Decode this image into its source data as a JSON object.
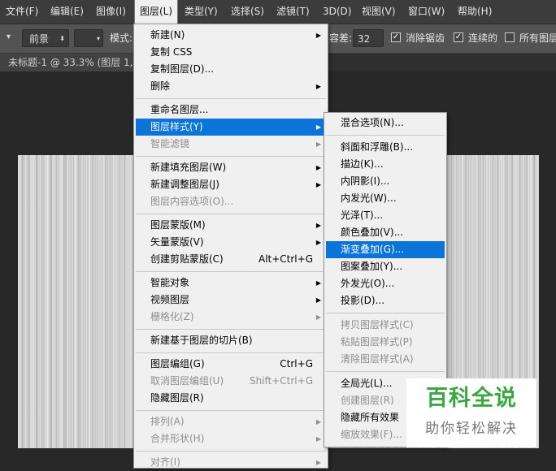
{
  "menubar": {
    "items": [
      "文件(F)",
      "编辑(E)",
      "图像(I)",
      "图层(L)",
      "类型(Y)",
      "选择(S)",
      "滤镜(T)",
      "3D(D)",
      "视图(V)",
      "窗口(W)",
      "帮助(H)"
    ],
    "active": "图层(L)"
  },
  "options": {
    "fill_source": "前景",
    "mode_label": "模式:",
    "tolerance_label": "容差:",
    "tolerance_value": "32",
    "antialias_label": "消除锯齿",
    "contiguous_label": "连续的",
    "all_layers_label": "所有图层",
    "antialias_checked": true,
    "contiguous_checked": true,
    "all_layers_checked": false
  },
  "doc_tab": {
    "title": "未标题-1 @ 33.3% (图层 1,"
  },
  "layer_menu": [
    {
      "label": "新建(N)",
      "submenu": true
    },
    {
      "label": "复制 CSS"
    },
    {
      "label": "复制图层(D)..."
    },
    {
      "label": "删除",
      "submenu": true
    },
    {
      "sep": true
    },
    {
      "label": "重命名图层..."
    },
    {
      "label": "图层样式(Y)",
      "submenu": true,
      "highlighted": true
    },
    {
      "label": "智能滤镜",
      "submenu": true,
      "disabled": true
    },
    {
      "sep": true
    },
    {
      "label": "新建填充图层(W)",
      "submenu": true
    },
    {
      "label": "新建调整图层(J)",
      "submenu": true
    },
    {
      "label": "图层内容选项(O)...",
      "disabled": true
    },
    {
      "sep": true
    },
    {
      "label": "图层蒙版(M)",
      "submenu": true
    },
    {
      "label": "矢量蒙版(V)",
      "submenu": true
    },
    {
      "label": "创建剪贴蒙版(C)",
      "shortcut": "Alt+Ctrl+G"
    },
    {
      "sep": true
    },
    {
      "label": "智能对象",
      "submenu": true
    },
    {
      "label": "视频图层",
      "submenu": true
    },
    {
      "label": "栅格化(Z)",
      "submenu": true,
      "disabled": true
    },
    {
      "sep": true
    },
    {
      "label": "新建基于图层的切片(B)"
    },
    {
      "sep": true
    },
    {
      "label": "图层编组(G)",
      "shortcut": "Ctrl+G"
    },
    {
      "label": "取消图层编组(U)",
      "shortcut": "Shift+Ctrl+G",
      "disabled": true
    },
    {
      "label": "隐藏图层(R)"
    },
    {
      "sep": true
    },
    {
      "label": "排列(A)",
      "submenu": true,
      "disabled": true
    },
    {
      "label": "合并形状(H)",
      "submenu": true,
      "disabled": true
    },
    {
      "sep": true
    },
    {
      "label": "对齐(I)",
      "submenu": true,
      "disabled": true
    }
  ],
  "style_submenu": [
    {
      "label": "混合选项(N)..."
    },
    {
      "sep": true
    },
    {
      "label": "斜面和浮雕(B)..."
    },
    {
      "label": "描边(K)..."
    },
    {
      "label": "内阴影(I)..."
    },
    {
      "label": "内发光(W)..."
    },
    {
      "label": "光泽(T)..."
    },
    {
      "label": "颜色叠加(V)..."
    },
    {
      "label": "渐变叠加(G)...",
      "highlighted": true
    },
    {
      "label": "图案叠加(Y)..."
    },
    {
      "label": "外发光(O)..."
    },
    {
      "label": "投影(D)..."
    },
    {
      "sep": true
    },
    {
      "label": "拷贝图层样式(C)",
      "disabled": true
    },
    {
      "label": "粘贴图层样式(P)",
      "disabled": true
    },
    {
      "label": "清除图层样式(A)",
      "disabled": true
    },
    {
      "sep": true
    },
    {
      "label": "全局光(L)..."
    },
    {
      "label": "创建图层(R)",
      "disabled": true
    },
    {
      "label": "隐藏所有效果"
    },
    {
      "label": "缩放效果(F)...",
      "disabled": true
    }
  ],
  "watermark": {
    "main": "百科全说",
    "sub": "助你轻松解决"
  },
  "colors": {
    "highlight": "#0a74d9",
    "menu_bg": "#f0f0f0",
    "watermark_green": "#3aa743"
  }
}
